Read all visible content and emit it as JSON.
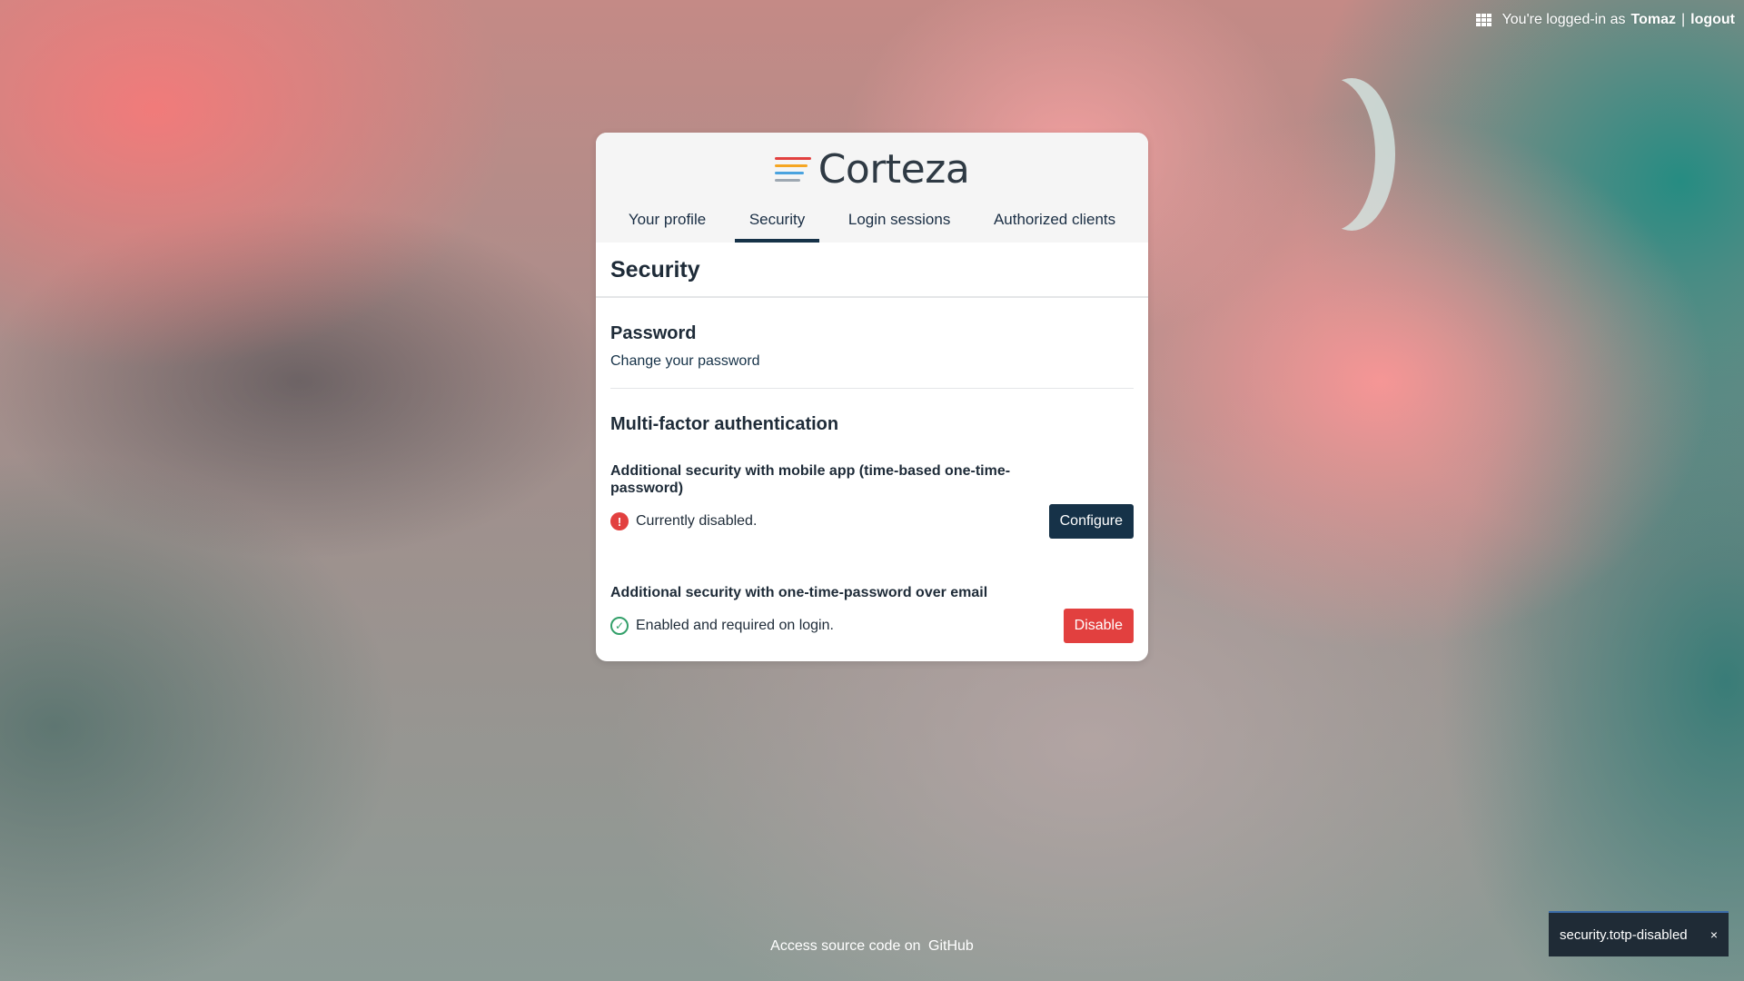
{
  "topbar": {
    "apps_icon": "apps-grid-icon",
    "prefix": "You're logged-in as",
    "username": "Tomaz",
    "separator": "|",
    "logout": "logout"
  },
  "logo": {
    "text": "Corteza",
    "colors": [
      "#e2403f",
      "#f5a623",
      "#4aa3df",
      "#9ea8b2"
    ]
  },
  "tabs": [
    {
      "label": "Your profile",
      "active": false
    },
    {
      "label": "Security",
      "active": true
    },
    {
      "label": "Login sessions",
      "active": false
    },
    {
      "label": "Authorized clients",
      "active": false
    }
  ],
  "page": {
    "title": "Security",
    "password": {
      "title": "Password",
      "link": "Change your password"
    },
    "mfa": {
      "title": "Multi-factor authentication",
      "totp": {
        "title": "Additional security with mobile app (time-based one-time-password)",
        "status": "Currently disabled.",
        "status_icon": "error-icon",
        "button": "Configure"
      },
      "email_otp": {
        "title": "Additional security with one-time-password over email",
        "status": "Enabled and required on login.",
        "status_icon": "check-circle-icon",
        "button": "Disable"
      }
    }
  },
  "footer": {
    "text": "Access source code on",
    "link": "GitHub"
  },
  "toast": {
    "message": "security.totp-disabled",
    "close": "×"
  },
  "colors": {
    "primary": "#163248",
    "danger": "#e2403f",
    "success": "#33a06a"
  }
}
